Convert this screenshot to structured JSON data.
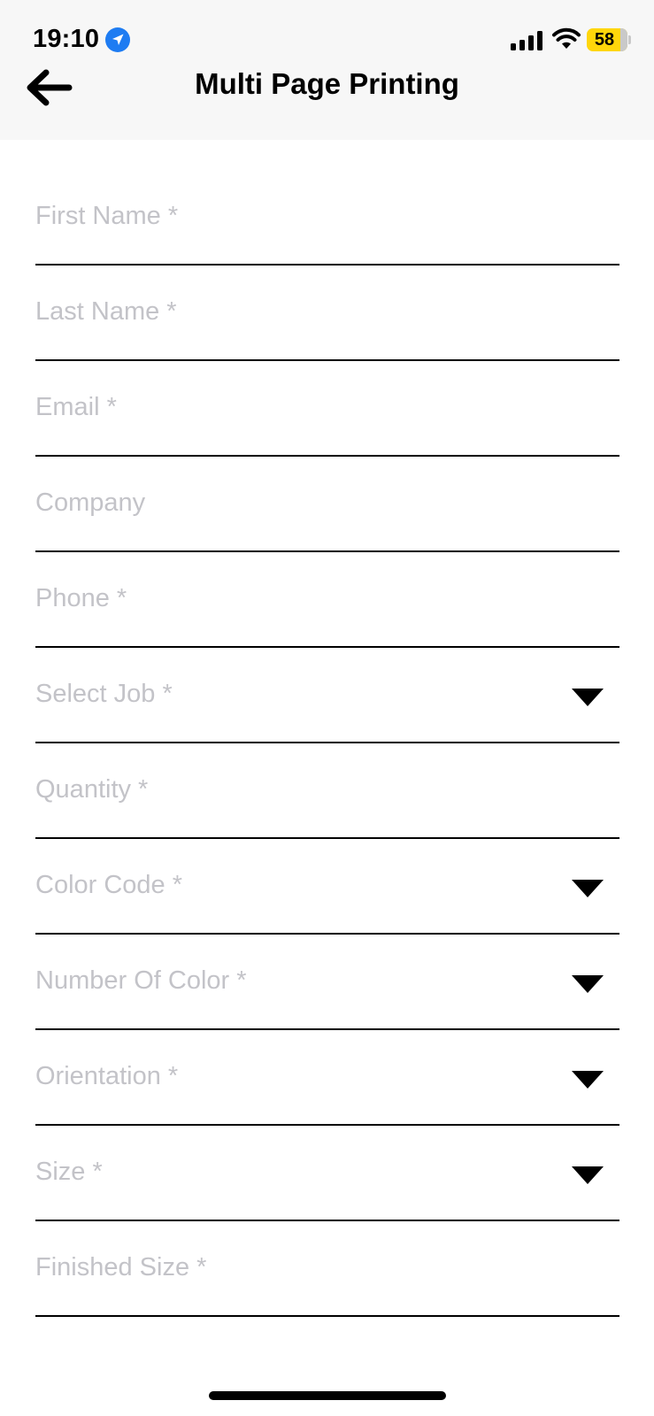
{
  "status_bar": {
    "time": "19:10",
    "battery_level": "58",
    "icons": [
      "location-arrow-icon",
      "cellular-signal-icon",
      "wifi-icon",
      "battery-icon"
    ],
    "battery_color": "#ffd60a",
    "location_color": "#1e7cf2"
  },
  "header": {
    "title": "Multi Page Printing",
    "back_icon": "arrow-left-icon"
  },
  "form": {
    "fields": [
      {
        "placeholder": "First Name *",
        "type": "text"
      },
      {
        "placeholder": "Last Name *",
        "type": "text"
      },
      {
        "placeholder": "Email *",
        "type": "text"
      },
      {
        "placeholder": "Company",
        "type": "text"
      },
      {
        "placeholder": "Phone *",
        "type": "text"
      },
      {
        "placeholder": "Select Job *",
        "type": "select"
      },
      {
        "placeholder": "Quantity *",
        "type": "text"
      },
      {
        "placeholder": "Color Code *",
        "type": "select"
      },
      {
        "placeholder": "Number Of Color *",
        "type": "select"
      },
      {
        "placeholder": "Orientation *",
        "type": "select"
      },
      {
        "placeholder": "Size *",
        "type": "select"
      },
      {
        "placeholder": "Finished Size *",
        "type": "text"
      }
    ]
  },
  "colors": {
    "placeholder_text": "#c3c3c8",
    "underline": "#000000",
    "header_background": "#f7f7f7"
  }
}
